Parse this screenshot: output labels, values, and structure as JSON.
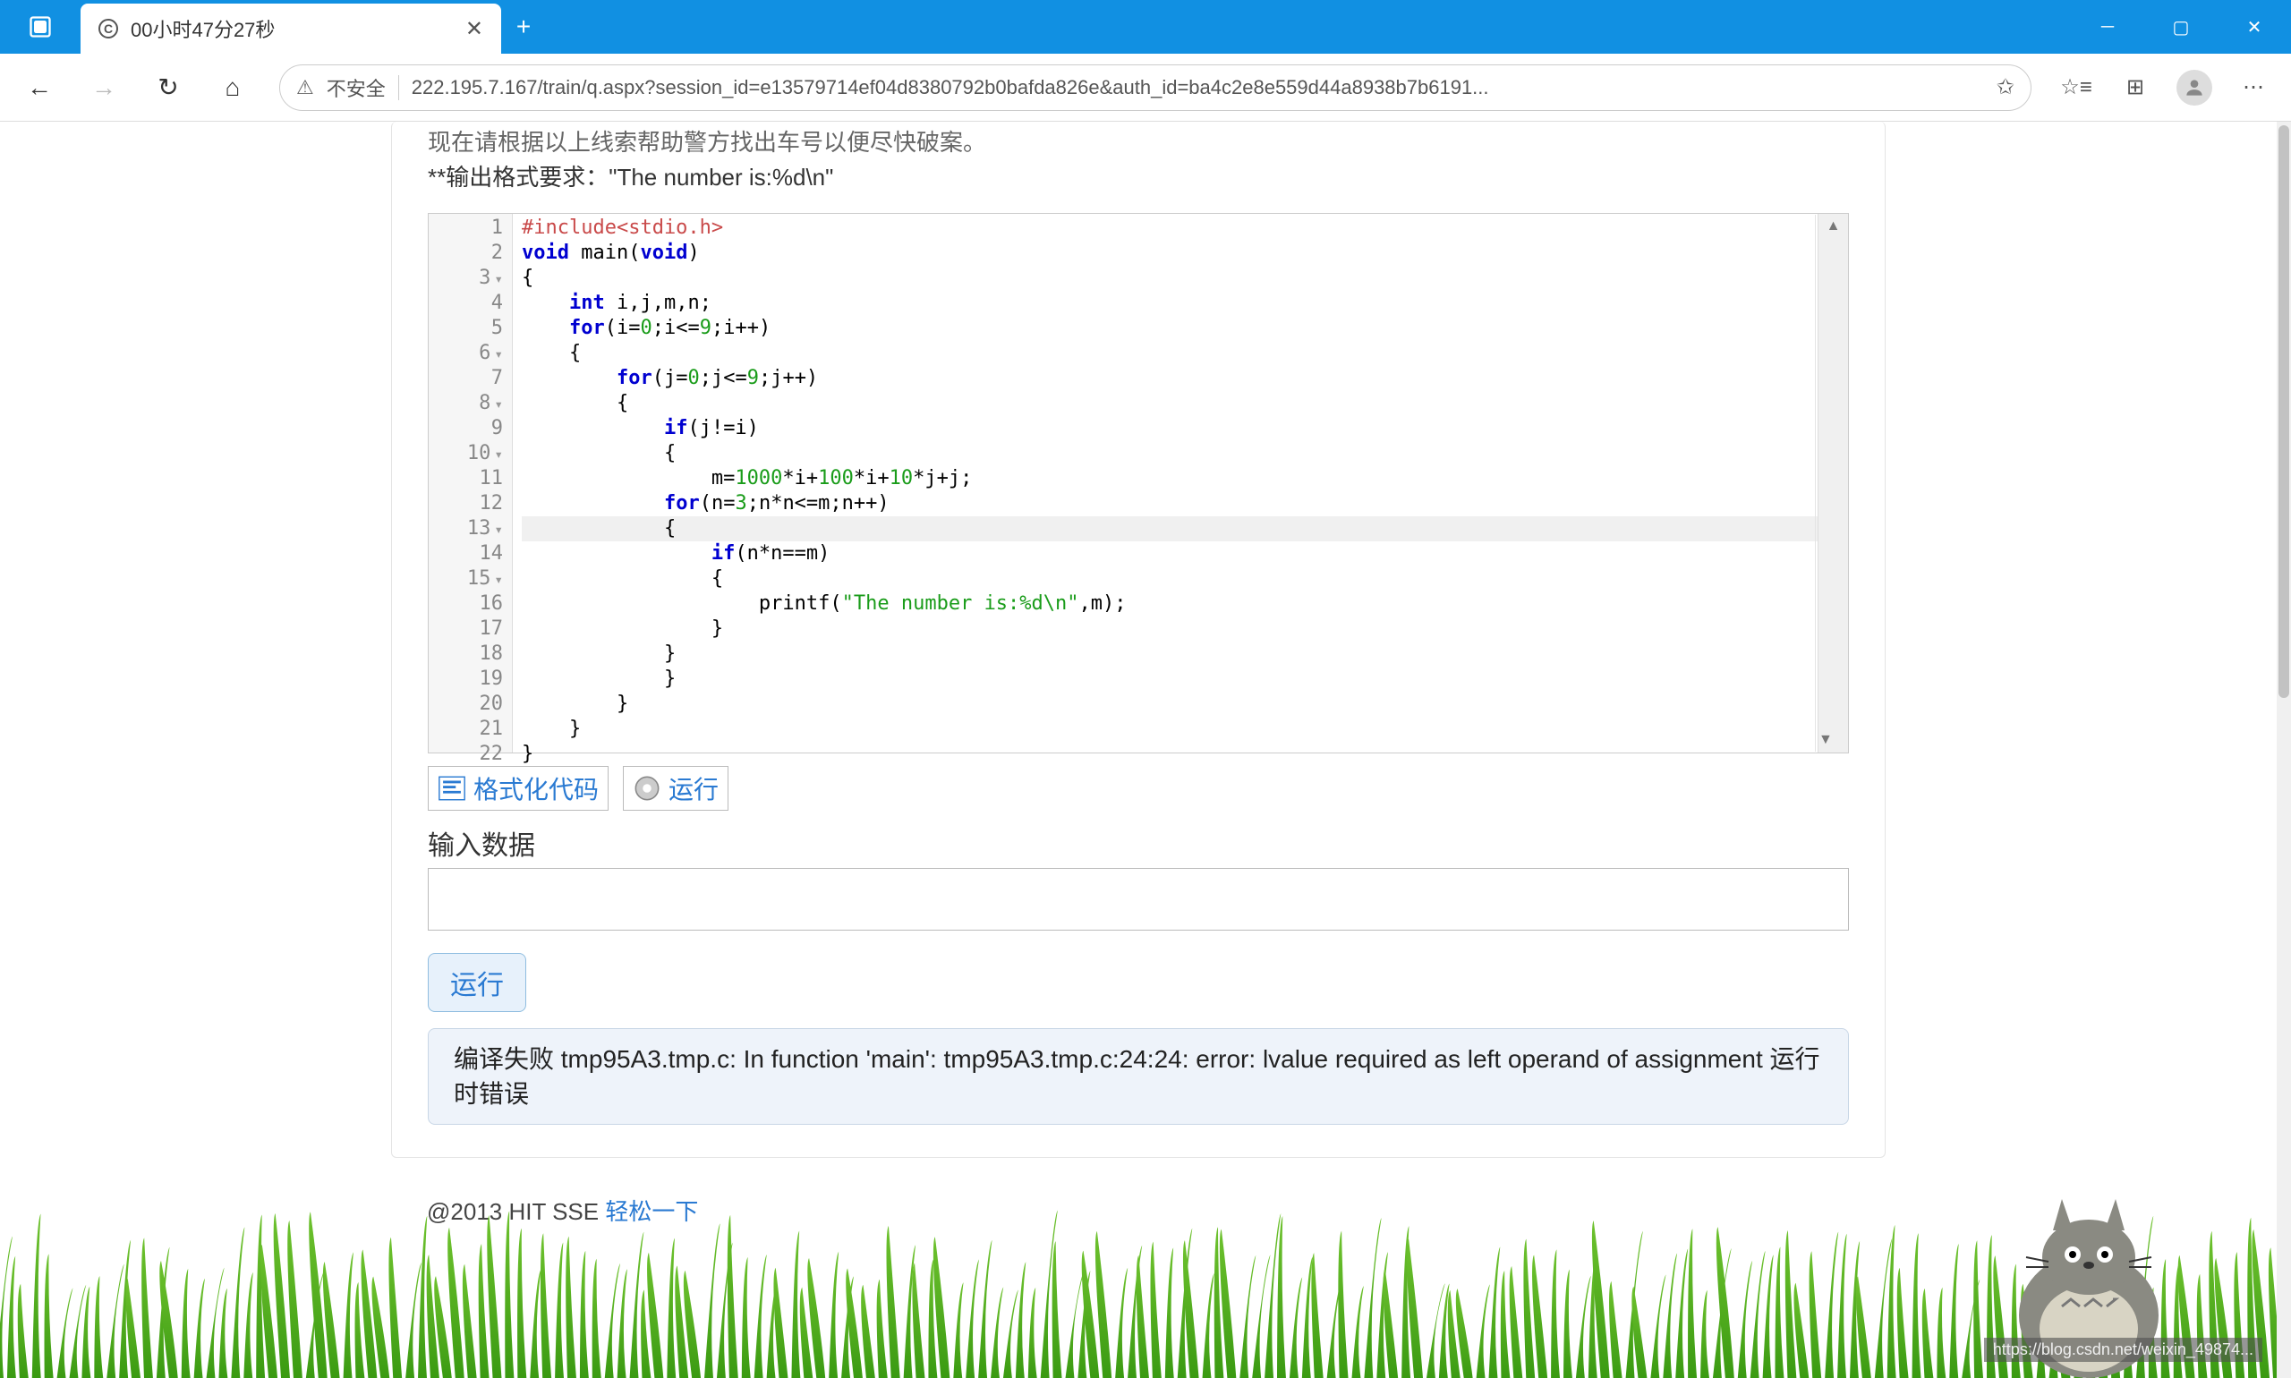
{
  "browser": {
    "tab_title": "00小时47分27秒",
    "insecure_label": "不安全",
    "url": "222.195.7.167/train/q.aspx?session_id=e13579714ef04d8380792b0bafda826e&auth_id=ba4c2e8e559d44a8938b7b6191..."
  },
  "problem": {
    "line1": "现在请根据以上线索帮助警方找出车号以便尽快破案。",
    "line2": "**输出格式要求：\"The number is:%d\\n\""
  },
  "code": {
    "lines": [
      {
        "n": "1",
        "fold": "",
        "html": "<span class='pp'>#include&lt;stdio.h&gt;</span>"
      },
      {
        "n": "2",
        "fold": "",
        "html": "<span class='kw'>void</span> main(<span class='kw'>void</span>)"
      },
      {
        "n": "3",
        "fold": "▾",
        "html": "{"
      },
      {
        "n": "4",
        "fold": "",
        "html": "    <span class='typ'>int</span> i,j,m,n;"
      },
      {
        "n": "5",
        "fold": "",
        "html": "    <span class='kw'>for</span>(i=<span class='num'>0</span>;i&lt;=<span class='num'>9</span>;i++)"
      },
      {
        "n": "6",
        "fold": "▾",
        "html": "    {"
      },
      {
        "n": "7",
        "fold": "",
        "html": "        <span class='kw'>for</span>(j=<span class='num'>0</span>;j&lt;=<span class='num'>9</span>;j++)"
      },
      {
        "n": "8",
        "fold": "▾",
        "html": "        {"
      },
      {
        "n": "9",
        "fold": "",
        "html": "            <span class='kw'>if</span>(j!=i)"
      },
      {
        "n": "10",
        "fold": "▾",
        "html": "            {"
      },
      {
        "n": "11",
        "fold": "",
        "html": "                m=<span class='num'>1000</span>*i+<span class='num'>100</span>*i+<span class='num'>10</span>*j+j;"
      },
      {
        "n": "12",
        "fold": "",
        "html": "            <span class='kw'>for</span>(n=<span class='num'>3</span>;n*n&lt;=m;n++)"
      },
      {
        "n": "13",
        "fold": "▾",
        "html": "            {",
        "active": true
      },
      {
        "n": "14",
        "fold": "",
        "html": "                <span class='kw'>if</span>(n*n==m)"
      },
      {
        "n": "15",
        "fold": "▾",
        "html": "                {"
      },
      {
        "n": "16",
        "fold": "",
        "html": "                    printf(<span class='str'>\"The number is:%d\\n\"</span>,m);"
      },
      {
        "n": "17",
        "fold": "",
        "html": "                }"
      },
      {
        "n": "18",
        "fold": "",
        "html": "            }"
      },
      {
        "n": "19",
        "fold": "",
        "html": "            }"
      },
      {
        "n": "20",
        "fold": "",
        "html": "        }"
      },
      {
        "n": "21",
        "fold": "",
        "html": "    }"
      },
      {
        "n": "22",
        "fold": "",
        "html": "}"
      }
    ]
  },
  "buttons": {
    "format": "格式化代码",
    "run_small": "运行",
    "run_big": "运行"
  },
  "input_label": "输入数据",
  "error_text": "编译失败 tmp95A3.tmp.c: In function 'main': tmp95A3.tmp.c:24:24: error: lvalue required as left operand of assignment 运行时错误",
  "footer": {
    "copyright": "@2013 HIT SSE ",
    "link": "轻松一下"
  },
  "watermark": "https://blog.csdn.net/weixin_49874..."
}
